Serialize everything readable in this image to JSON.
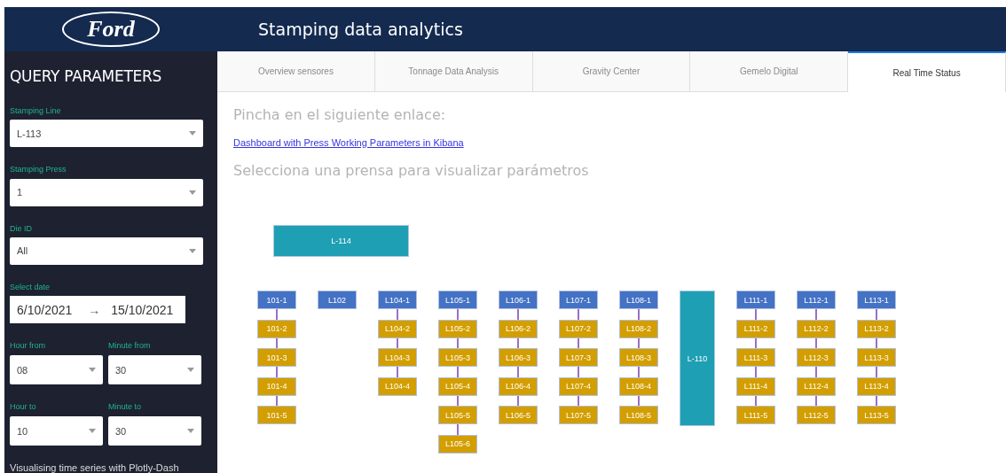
{
  "header": {
    "logo": "Ford",
    "title": "Stamping data analytics"
  },
  "sidebar": {
    "title": "QUERY PARAMETERS",
    "fields": [
      {
        "kind": "dropdown",
        "label": "Stamping Line",
        "value": "L-113"
      },
      {
        "kind": "dropdown",
        "label": "Stamping Press",
        "value": "1"
      },
      {
        "kind": "dropdown",
        "label": "Die ID",
        "value": "All"
      },
      {
        "kind": "daterange",
        "label": "Select date",
        "start": "6/10/2021",
        "arrow": "→",
        "end": "15/10/2021"
      },
      {
        "kind": "pair",
        "items": [
          {
            "label": "Hour from",
            "value": "08"
          },
          {
            "label": "Minute from",
            "value": "30"
          }
        ]
      },
      {
        "kind": "pair",
        "items": [
          {
            "label": "Hour to",
            "value": "10"
          },
          {
            "label": "Minute to",
            "value": "30"
          }
        ]
      }
    ],
    "footer": "Visualising time series with Plotly-Dash"
  },
  "tabs": [
    {
      "label": "Overview sensores",
      "selected": false
    },
    {
      "label": "Tonnage Data Analysis",
      "selected": false
    },
    {
      "label": "Gravity Center",
      "selected": false
    },
    {
      "label": "Gemelo Digital",
      "selected": false
    },
    {
      "label": "Real Time Status",
      "selected": true
    }
  ],
  "content": {
    "heading": "Pincha en el siguiente enlace:",
    "link": "Dashboard with Press Working Parameters in Kibana",
    "subheading": "Selecciona una prensa para visualizar parámetros"
  },
  "diagram": {
    "top_line": "L-114",
    "lines": [
      {
        "kind": "chain",
        "presses": [
          {
            "label": "101-1",
            "kind": "head"
          },
          {
            "label": "101-2",
            "kind": "stage"
          },
          {
            "label": "101-3",
            "kind": "stage"
          },
          {
            "label": "101-4",
            "kind": "stage"
          },
          {
            "label": "101-5",
            "kind": "stage"
          }
        ]
      },
      {
        "kind": "chain",
        "presses": [
          {
            "label": "L102",
            "kind": "head"
          }
        ]
      },
      {
        "kind": "chain",
        "presses": [
          {
            "label": "L104-1",
            "kind": "head"
          },
          {
            "label": "L104-2",
            "kind": "stage"
          },
          {
            "label": "L104-3",
            "kind": "stage"
          },
          {
            "label": "L104-4",
            "kind": "stage"
          }
        ]
      },
      {
        "kind": "chain",
        "presses": [
          {
            "label": "L105-1",
            "kind": "head"
          },
          {
            "label": "L105-2",
            "kind": "stage"
          },
          {
            "label": "L105-3",
            "kind": "stage"
          },
          {
            "label": "L105-4",
            "kind": "stage"
          },
          {
            "label": "L105-5",
            "kind": "stage"
          },
          {
            "label": "L105-6",
            "kind": "stage"
          }
        ]
      },
      {
        "kind": "chain",
        "presses": [
          {
            "label": "L106-1",
            "kind": "head"
          },
          {
            "label": "L106-2",
            "kind": "stage"
          },
          {
            "label": "L106-3",
            "kind": "stage"
          },
          {
            "label": "L106-4",
            "kind": "stage"
          },
          {
            "label": "L106-5",
            "kind": "stage"
          }
        ]
      },
      {
        "kind": "chain",
        "presses": [
          {
            "label": "L107-1",
            "kind": "head"
          },
          {
            "label": "L107-2",
            "kind": "stage"
          },
          {
            "label": "L107-3",
            "kind": "stage"
          },
          {
            "label": "L107-4",
            "kind": "stage"
          },
          {
            "label": "L107-5",
            "kind": "stage"
          }
        ]
      },
      {
        "kind": "chain",
        "presses": [
          {
            "label": "L108-1",
            "kind": "head"
          },
          {
            "label": "L108-2",
            "kind": "stage"
          },
          {
            "label": "L108-3",
            "kind": "stage"
          },
          {
            "label": "L108-4",
            "kind": "stage"
          },
          {
            "label": "L108-5",
            "kind": "stage"
          }
        ]
      },
      {
        "kind": "block",
        "label": "L-110"
      },
      {
        "kind": "chain",
        "presses": [
          {
            "label": "L111-1",
            "kind": "head"
          },
          {
            "label": "L111-2",
            "kind": "stage"
          },
          {
            "label": "L111-3",
            "kind": "stage"
          },
          {
            "label": "L111-4",
            "kind": "stage"
          },
          {
            "label": "L111-5",
            "kind": "stage"
          }
        ]
      },
      {
        "kind": "chain",
        "presses": [
          {
            "label": "L112-1",
            "kind": "head"
          },
          {
            "label": "L112-2",
            "kind": "stage"
          },
          {
            "label": "L112-3",
            "kind": "stage"
          },
          {
            "label": "L112-4",
            "kind": "stage"
          },
          {
            "label": "L112-5",
            "kind": "stage"
          }
        ]
      },
      {
        "kind": "chain",
        "presses": [
          {
            "label": "L113-1",
            "kind": "head"
          },
          {
            "label": "L113-2",
            "kind": "stage"
          },
          {
            "label": "L113-3",
            "kind": "stage"
          },
          {
            "label": "L113-4",
            "kind": "stage"
          },
          {
            "label": "L113-5",
            "kind": "stage"
          }
        ]
      }
    ]
  }
}
